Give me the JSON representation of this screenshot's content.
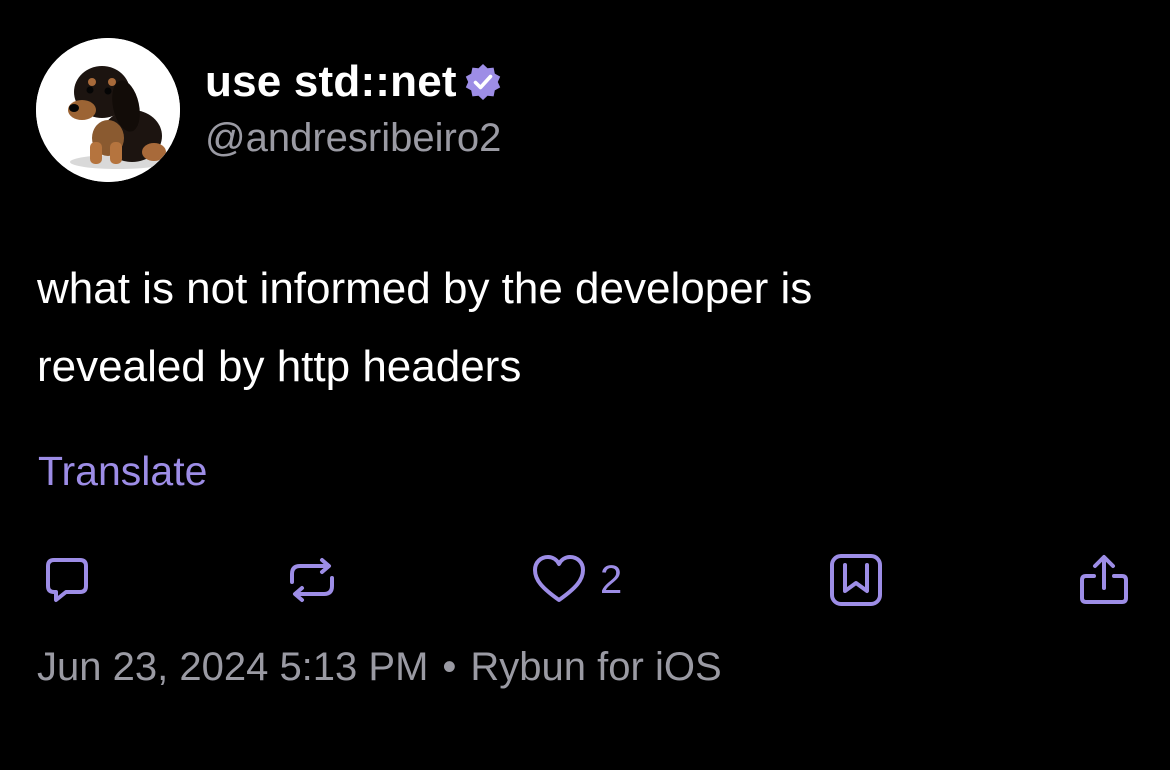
{
  "author": {
    "display_name": "use std::net",
    "handle": "@andresribeiro2",
    "verified": true,
    "avatar_subject": "dachshund puppy"
  },
  "post": {
    "text_line1": "what is not informed by the developer is",
    "text_line2": "revealed by http headers"
  },
  "translate_label": "Translate",
  "actions": {
    "like_count": "2"
  },
  "meta": {
    "date": "Jun 23, 2024",
    "time": "5:13 PM",
    "separator": "•",
    "client": "Rybun for iOS"
  },
  "colors": {
    "background": "#000000",
    "accent": "#9d8de6",
    "secondary_text": "#9a9aa3",
    "primary_text": "#ffffff"
  },
  "icons": [
    "verified-badge-icon",
    "reply-icon",
    "repost-icon",
    "like-icon",
    "bookmark-icon",
    "share-icon"
  ]
}
